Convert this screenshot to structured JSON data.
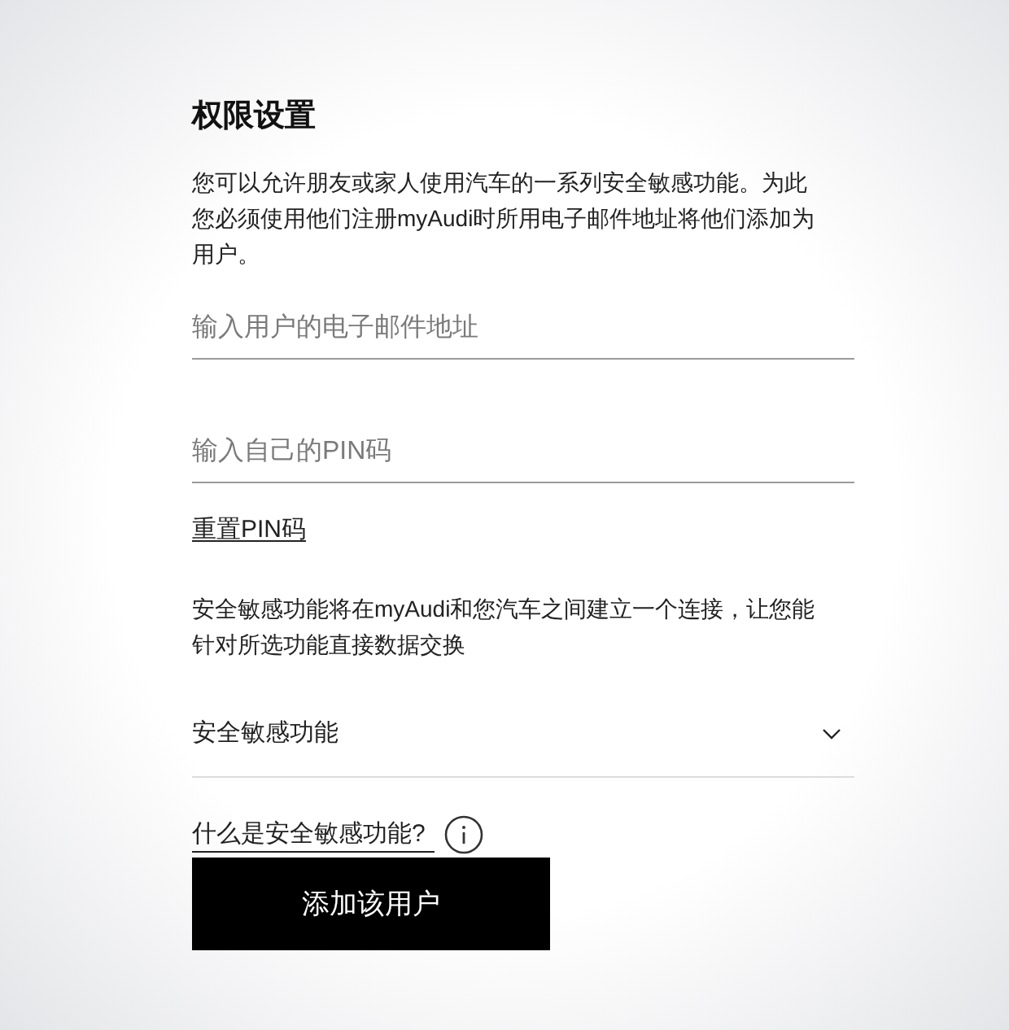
{
  "title": "权限设置",
  "description": "您可以允许朋友或家人使用汽车的一系列安全敏感功能。为此您必须使用他们注册myAudi时所用电子邮件地址将他们添加为用户。",
  "fields": [
    {
      "placeholder": "输入用户的电子邮件地址"
    },
    {
      "placeholder": "输入自己的PIN码"
    }
  ],
  "reset_link": "重置PIN码",
  "info_text": "安全敏感功能将在myAudi和您汽车之间建立一个连接，让您能针对所选功能直接数据交换",
  "dropdown": {
    "label": "安全敏感功能",
    "expanded": false
  },
  "help_link": "什么是安全敏感功能?",
  "submit_button": "添加该用户"
}
